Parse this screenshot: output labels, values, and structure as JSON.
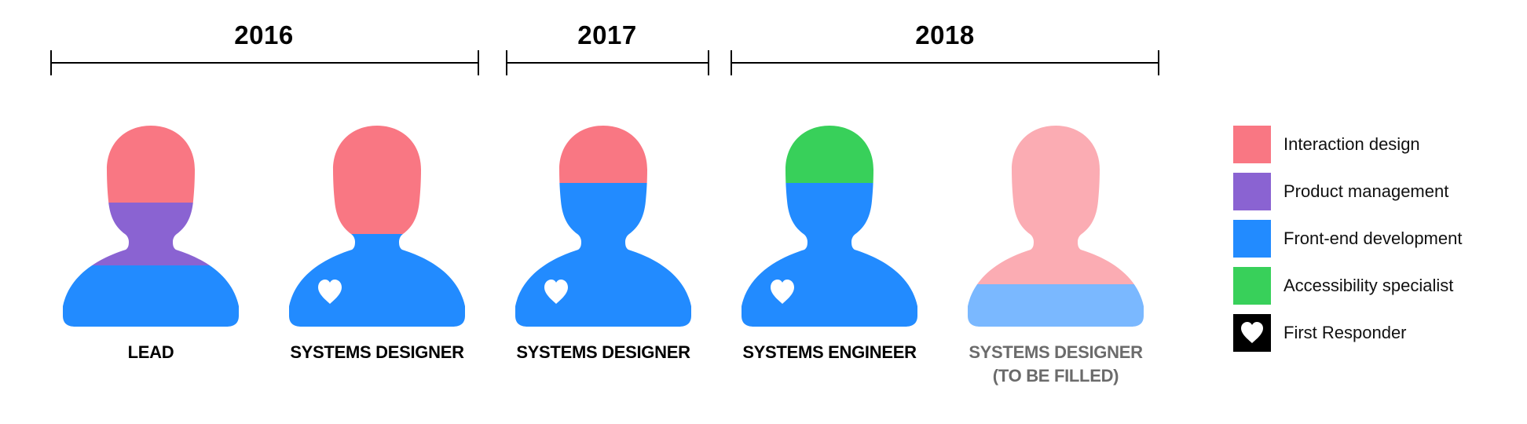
{
  "colors": {
    "interaction_design": "#F97783",
    "product_management": "#8A63D2",
    "front_end_development": "#228BFF",
    "accessibility_specialist": "#38D05A",
    "first_responder_bg": "#000000",
    "interaction_design_planned": "#FBACB3",
    "front_end_development_planned": "#7AB8FF",
    "heart": "#FFFFFF"
  },
  "timeline": {
    "periods": [
      {
        "year": "2016",
        "members": 2
      },
      {
        "year": "2017",
        "members": 1
      },
      {
        "year": "2018",
        "members": 2
      }
    ]
  },
  "team": [
    {
      "role": "LEAD",
      "role_line2": "",
      "year": "2016",
      "status": "filled",
      "first_responder": false,
      "skills": [
        {
          "skill": "Interaction design",
          "share": 0.3,
          "color_key": "interaction_design"
        },
        {
          "skill": "Product management",
          "share": 0.3,
          "color_key": "product_management"
        },
        {
          "skill": "Front-end development",
          "share": 0.4,
          "color_key": "front_end_development"
        }
      ]
    },
    {
      "role": "SYSTEMS DESIGNER",
      "role_line2": "",
      "year": "2016",
      "status": "filled",
      "first_responder": true,
      "skills": [
        {
          "skill": "Interaction design",
          "share": 0.5,
          "color_key": "interaction_design"
        },
        {
          "skill": "Front-end development",
          "share": 0.5,
          "color_key": "front_end_development"
        }
      ]
    },
    {
      "role": "SYSTEMS DESIGNER",
      "role_line2": "",
      "year": "2017",
      "status": "filled",
      "first_responder": true,
      "skills": [
        {
          "skill": "Interaction design",
          "share": 0.25,
          "color_key": "interaction_design"
        },
        {
          "skill": "Front-end development",
          "share": 0.75,
          "color_key": "front_end_development"
        }
      ]
    },
    {
      "role": "SYSTEMS ENGINEER",
      "role_line2": "",
      "year": "2018",
      "status": "filled",
      "first_responder": true,
      "skills": [
        {
          "skill": "Accessibility specialist",
          "share": 0.25,
          "color_key": "accessibility_specialist"
        },
        {
          "skill": "Front-end development",
          "share": 0.75,
          "color_key": "front_end_development"
        }
      ]
    },
    {
      "role": "SYSTEMS DESIGNER",
      "role_line2": "(TO BE FILLED)",
      "year": "2018",
      "status": "to be filled",
      "first_responder": false,
      "skills": [
        {
          "skill": "Interaction design",
          "share": 0.75,
          "color_key": "interaction_design_planned"
        },
        {
          "skill": "Front-end development",
          "share": 0.25,
          "color_key": "front_end_development_planned"
        }
      ]
    }
  ],
  "legend": {
    "items": [
      {
        "label": "Interaction design",
        "color_key": "interaction_design",
        "icon": ""
      },
      {
        "label": "Product management",
        "color_key": "product_management",
        "icon": ""
      },
      {
        "label": "Front-end development",
        "color_key": "front_end_development",
        "icon": ""
      },
      {
        "label": "Accessibility specialist",
        "color_key": "accessibility_specialist",
        "icon": ""
      },
      {
        "label": "First Responder",
        "color_key": "first_responder_bg",
        "icon": "heart-icon"
      }
    ]
  }
}
